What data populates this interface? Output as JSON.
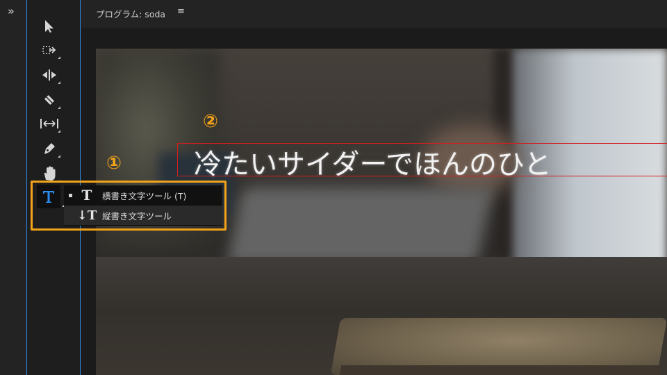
{
  "panel": {
    "expand_label": "»"
  },
  "tools": [
    {
      "name": "selection-tool",
      "icon": "arrow-cursor-icon"
    },
    {
      "name": "track-select-forward-tool",
      "icon": "track-select-icon"
    },
    {
      "name": "ripple-edit-tool",
      "icon": "ripple-edit-icon"
    },
    {
      "name": "razor-tool",
      "icon": "razor-icon"
    },
    {
      "name": "slip-tool",
      "icon": "slip-icon"
    },
    {
      "name": "pen-tool",
      "icon": "pen-icon"
    },
    {
      "name": "hand-tool",
      "icon": "hand-icon"
    },
    {
      "name": "type-tool",
      "icon": "type-t-icon",
      "glyph": "T",
      "accent": "#2d8ceb"
    }
  ],
  "program_monitor": {
    "title": "プログラム: soda",
    "menu_glyph": "≡"
  },
  "video": {
    "caption": "冷たいサイダーでほんのひと"
  },
  "flyout": {
    "items": [
      {
        "icon_glyph": "T",
        "label": "横書き文字ツール (T)",
        "selected": true
      },
      {
        "icon_glyph": "↓T",
        "label": "縦書き文字ツール",
        "selected": false
      }
    ]
  },
  "annotations": {
    "marker_1": "①",
    "marker_2": "②",
    "highlight_color": "#f2a31a",
    "textbox_color": "#d21e1e"
  }
}
